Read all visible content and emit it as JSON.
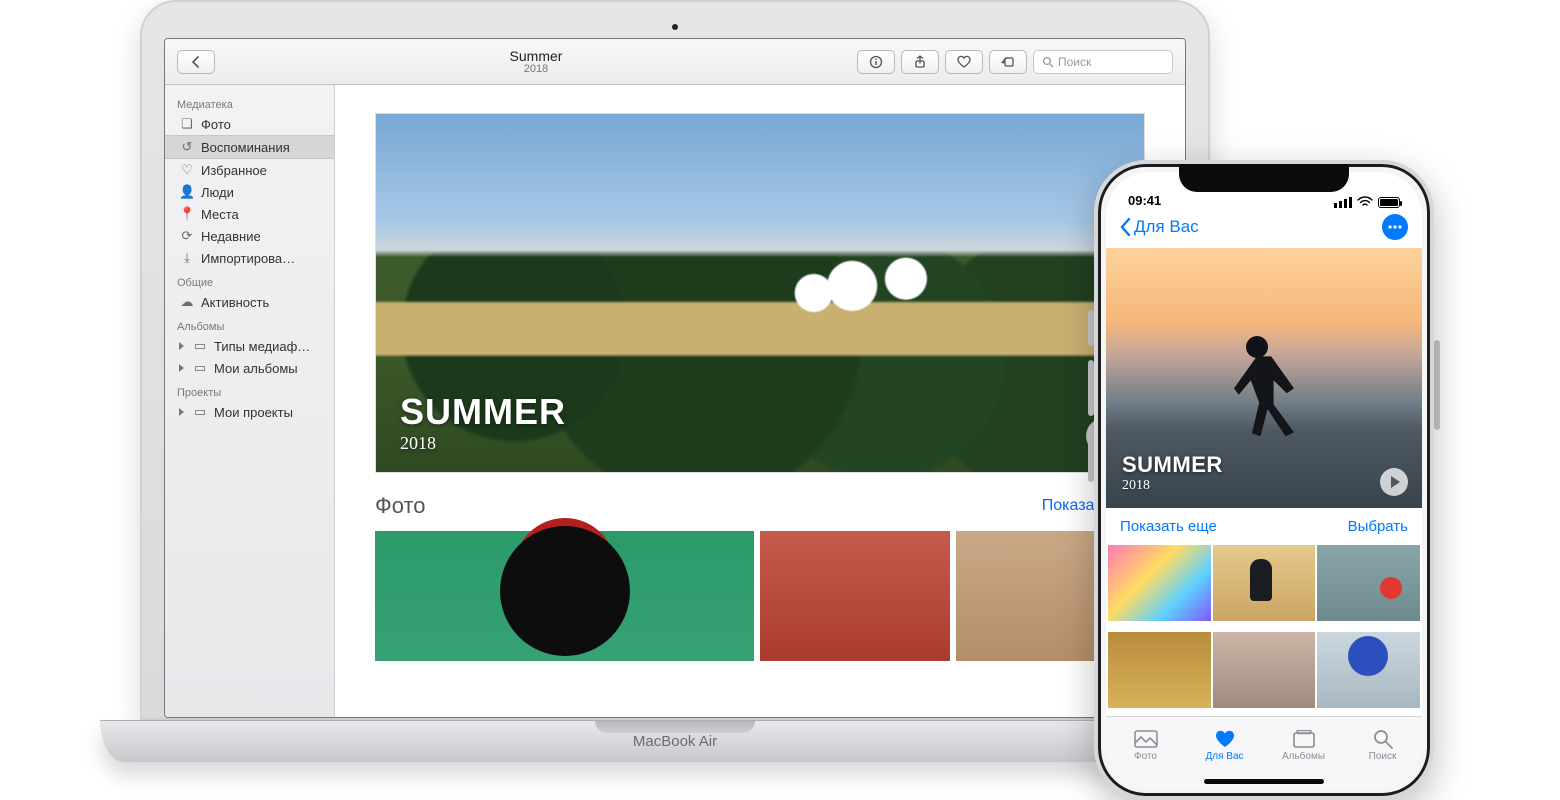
{
  "mac": {
    "title": "Summer",
    "subtitle": "2018",
    "device_label": "MacBook Air",
    "toolbar": {
      "search_placeholder": "Поиск"
    },
    "sidebar": {
      "sections": {
        "library": "Медиатека",
        "shared": "Общие",
        "albums": "Альбомы",
        "projects": "Проекты"
      },
      "library_items": {
        "photos": "Фото",
        "memories": "Воспоминания",
        "favorites": "Избранное",
        "people": "Люди",
        "places": "Места",
        "recent": "Недавние",
        "imports": "Импортирова…"
      },
      "shared_items": {
        "activity": "Активность"
      },
      "album_items": {
        "media_types": "Типы медиаф…",
        "my_albums": "Мои альбомы"
      },
      "project_items": {
        "my_projects": "Мои проекты"
      }
    },
    "hero": {
      "title": "SUMMER",
      "year": "2018"
    },
    "photos_section": {
      "heading": "Фото",
      "show_all": "Показать еще"
    }
  },
  "iphone": {
    "status_time": "09:41",
    "back_label": "Для Вас",
    "hero": {
      "title": "SUMMER",
      "year": "2018"
    },
    "links": {
      "show_more": "Показать еще",
      "select": "Выбрать"
    },
    "tabs": {
      "photos": "Фото",
      "for_you": "Для Вас",
      "albums": "Альбомы",
      "search": "Поиск"
    }
  }
}
